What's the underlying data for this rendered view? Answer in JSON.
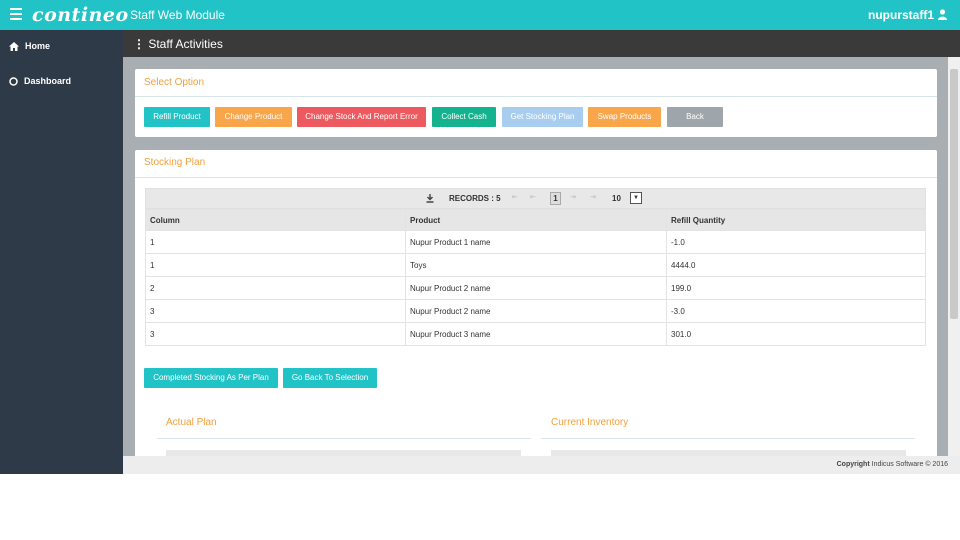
{
  "header": {
    "logo": "contineo",
    "module": "Staff Web Module",
    "user": "nupurstaff1"
  },
  "sidebar": {
    "items": [
      {
        "label": "Home"
      },
      {
        "label": "Dashboard"
      }
    ]
  },
  "page_title": "Staff Activities",
  "select_option": {
    "title": "Select Option",
    "buttons": [
      "Refill Product",
      "Change Product",
      "Change Stock And Report Error",
      "Collect Cash",
      "Get Stocking Plan",
      "Swap Products",
      "Back"
    ]
  },
  "stocking_plan": {
    "title": "Stocking Plan",
    "pager": {
      "records_label": "RECORDS : 5",
      "current_page": "1",
      "page_size": "10"
    },
    "columns": [
      "Column",
      "Product",
      "Refill Quantity"
    ],
    "rows": [
      [
        "1",
        "Nupur Product 1 name",
        "-1.0"
      ],
      [
        "1",
        "Toys",
        "4444.0"
      ],
      [
        "2",
        "Nupur Product 2 name",
        "199.0"
      ],
      [
        "3",
        "Nupur Product 2 name",
        "-3.0"
      ],
      [
        "3",
        "Nupur Product 3 name",
        "301.0"
      ]
    ],
    "completed_button": "Completed Stocking As Per Plan",
    "back_button": "Go Back To Selection",
    "actual_plan": "Actual Plan",
    "current_inventory": "Current Inventory"
  },
  "footer": {
    "copyright_label": "Copyright",
    "company": "Indicus Software © 2016"
  },
  "colors": {
    "topbar": "#22c3c6",
    "sidebar": "#2f3a48",
    "accent": "#f2a03d"
  }
}
